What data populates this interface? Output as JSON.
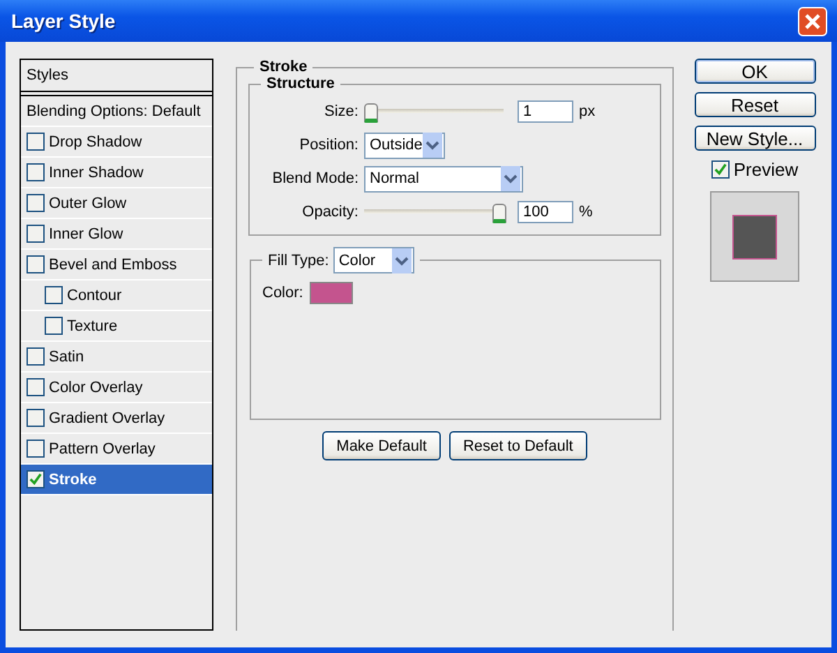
{
  "window": {
    "title": "Layer Style"
  },
  "styles_panel": {
    "heading": "Styles",
    "items": [
      {
        "label": "Blending Options: Default",
        "kind": "plain",
        "selected": false
      },
      {
        "label": "Drop Shadow",
        "kind": "check",
        "checked": false,
        "selected": false
      },
      {
        "label": "Inner Shadow",
        "kind": "check",
        "checked": false,
        "selected": false
      },
      {
        "label": "Outer Glow",
        "kind": "check",
        "checked": false,
        "selected": false
      },
      {
        "label": "Inner Glow",
        "kind": "check",
        "checked": false,
        "selected": false
      },
      {
        "label": "Bevel and Emboss",
        "kind": "check",
        "checked": false,
        "selected": false,
        "children": [
          {
            "label": "Contour",
            "kind": "check",
            "checked": false,
            "selected": false
          },
          {
            "label": "Texture",
            "kind": "check",
            "checked": false,
            "selected": false
          }
        ]
      },
      {
        "label": "Satin",
        "kind": "check",
        "checked": false,
        "selected": false
      },
      {
        "label": "Color Overlay",
        "kind": "check",
        "checked": false,
        "selected": false
      },
      {
        "label": "Gradient Overlay",
        "kind": "check",
        "checked": false,
        "selected": false
      },
      {
        "label": "Pattern Overlay",
        "kind": "check",
        "checked": false,
        "selected": false
      },
      {
        "label": "Stroke",
        "kind": "check",
        "checked": true,
        "selected": true
      }
    ]
  },
  "stroke": {
    "title": "Stroke",
    "structure": {
      "title": "Structure",
      "size": {
        "label": "Size:",
        "level": 0,
        "value": "1",
        "unit": "px"
      },
      "position": {
        "label": "Position:",
        "value": "Outside"
      },
      "blend_mode": {
        "label": "Blend Mode:",
        "value": "Normal"
      },
      "opacity": {
        "label": "Opacity:",
        "level": 1,
        "value": "100",
        "unit": "%"
      }
    },
    "fill": {
      "label": "Fill Type:",
      "value": "Color",
      "color_label": "Color:",
      "color": "#c4548e"
    },
    "buttons": [
      "Make Default",
      "Reset to Default"
    ]
  },
  "actions": [
    "OK",
    "Reset",
    "New Style..."
  ],
  "preview": {
    "label": "Preview",
    "checked": true
  }
}
